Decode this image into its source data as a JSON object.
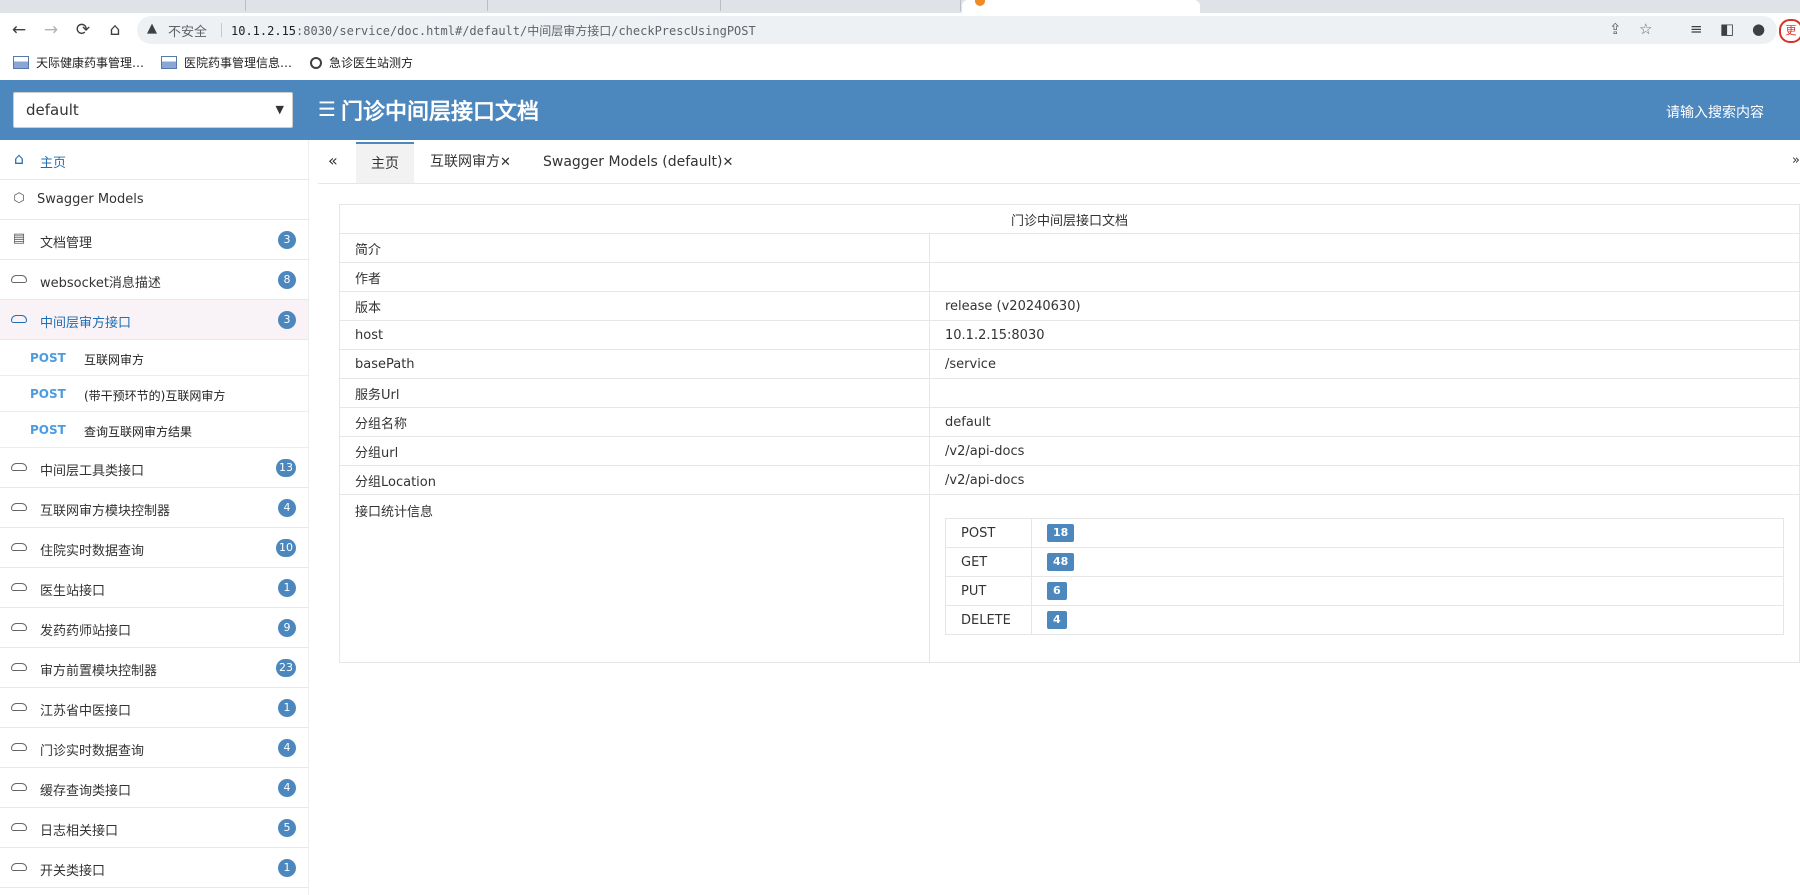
{
  "browser": {
    "nav": {
      "back": "←",
      "forward": "→",
      "reload": "⟳",
      "home": "⌂"
    },
    "security_label": "不安全",
    "url_host": "10.1.2.15",
    "url_rest": ":8030/service/doc.html#/default/中间层审方接口/checkPrescUsingPOST",
    "profile_initial": "更",
    "bookmarks": [
      "天际健康药事管理…",
      "医院药事管理信息…",
      "急诊医生站测方"
    ]
  },
  "header": {
    "group_select_value": "default",
    "menu_icon": "list-indent-icon",
    "title": "门诊中间层接口文档",
    "search_placeholder": "请输入搜索内容"
  },
  "sidebar": {
    "items": [
      {
        "label": "主页",
        "icon": "home-icon"
      },
      {
        "label": "Swagger Models",
        "icon": "models-icon"
      },
      {
        "label": "文档管理",
        "icon": "doc-settings-icon",
        "count": "3"
      },
      {
        "label": "websocket消息描述",
        "icon": "cloud-icon",
        "count": "8"
      },
      {
        "label": "中间层审方接口",
        "icon": "cloud-icon",
        "count": "3"
      },
      {
        "label": "中间层工具类接口",
        "icon": "cloud-icon",
        "count": "13"
      },
      {
        "label": "互联网审方模块控制器",
        "icon": "cloud-icon",
        "count": "4"
      },
      {
        "label": "住院实时数据查询",
        "icon": "cloud-icon",
        "count": "10"
      },
      {
        "label": "医生站接口",
        "icon": "cloud-icon",
        "count": "1"
      },
      {
        "label": "发药药师站接口",
        "icon": "cloud-icon",
        "count": "9"
      },
      {
        "label": "审方前置模块控制器",
        "icon": "cloud-icon",
        "count": "23"
      },
      {
        "label": "江苏省中医接口",
        "icon": "cloud-icon",
        "count": "1"
      },
      {
        "label": "门诊实时数据查询",
        "icon": "cloud-icon",
        "count": "4"
      },
      {
        "label": "缓存查询类接口",
        "icon": "cloud-icon",
        "count": "4"
      },
      {
        "label": "日志相关接口",
        "icon": "cloud-icon",
        "count": "5"
      },
      {
        "label": "开关类接口",
        "icon": "cloud-icon",
        "count": "1"
      }
    ],
    "sub_items": [
      {
        "method": "POST",
        "label": "互联网审方"
      },
      {
        "method": "POST",
        "label": "(带干预环节的)互联网审方"
      },
      {
        "method": "POST",
        "label": "查询互联网审方结果"
      }
    ]
  },
  "tabs": {
    "items": [
      {
        "label": "主页"
      },
      {
        "label": "互联网审方",
        "close": "✕"
      },
      {
        "label": "Swagger Models (default)",
        "close": "✕"
      }
    ],
    "right_edge": "»"
  },
  "doc": {
    "title": "门诊中间层接口文档",
    "rows": [
      {
        "key": "简介",
        "value": ""
      },
      {
        "key": "作者",
        "value": ""
      },
      {
        "key": "版本",
        "value": "release (v20240630)"
      },
      {
        "key": "host",
        "value": "10.1.2.15:8030"
      },
      {
        "key": "basePath",
        "value": "/service"
      },
      {
        "key": "服务Url",
        "value": ""
      },
      {
        "key": "分组名称",
        "value": "default"
      },
      {
        "key": "分组url",
        "value": "/v2/api-docs"
      },
      {
        "key": "分组Location",
        "value": "/v2/api-docs"
      }
    ],
    "stats_label": "接口统计信息",
    "stats": [
      {
        "method": "POST",
        "count": "18"
      },
      {
        "method": "GET",
        "count": "48"
      },
      {
        "method": "PUT",
        "count": "6"
      },
      {
        "method": "DELETE",
        "count": "4"
      }
    ]
  }
}
